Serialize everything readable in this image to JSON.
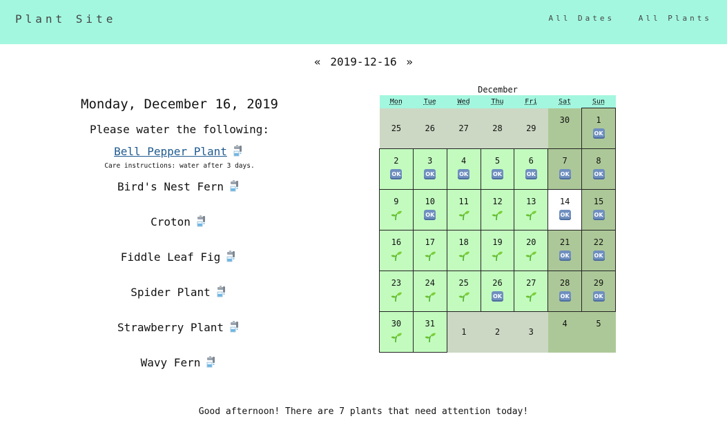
{
  "header": {
    "brand": "Plant Site",
    "nav": [
      "All Dates",
      "All Plants"
    ],
    "background": "#a3f7df"
  },
  "date_nav": {
    "prev": "«",
    "date": "2019-12-16",
    "next": "»"
  },
  "main": {
    "day_title": "Monday, December 16, 2019",
    "prompt": "Please water the following:",
    "plants": [
      {
        "name": "Bell Pepper Plant",
        "link": true,
        "care": "Care instructions: water after 3 days.",
        "icon": "watering-tap-icon"
      },
      {
        "name": "Bird's Nest Fern",
        "link": false,
        "icon": "watering-tap-icon"
      },
      {
        "name": "Croton",
        "link": false,
        "icon": "watering-tap-icon"
      },
      {
        "name": "Fiddle Leaf Fig",
        "link": false,
        "icon": "watering-tap-icon"
      },
      {
        "name": "Spider Plant",
        "link": false,
        "icon": "watering-tap-icon"
      },
      {
        "name": "Strawberry Plant",
        "link": false,
        "icon": "watering-tap-icon"
      },
      {
        "name": "Wavy Fern",
        "link": false,
        "icon": "watering-tap-icon"
      }
    ]
  },
  "calendar": {
    "month": "December",
    "weekdays": [
      "Mon",
      "Tue",
      "Wed",
      "Thu",
      "Fri",
      "Sat",
      "Sun"
    ],
    "weeks": [
      [
        {
          "day": "25",
          "type": "outside",
          "icon": "none"
        },
        {
          "day": "26",
          "type": "outside",
          "icon": "none"
        },
        {
          "day": "27",
          "type": "outside",
          "icon": "none"
        },
        {
          "day": "28",
          "type": "outside",
          "icon": "none"
        },
        {
          "day": "29",
          "type": "outside",
          "icon": "none"
        },
        {
          "day": "30",
          "type": "outwk",
          "icon": "none"
        },
        {
          "day": "1",
          "type": "curwk",
          "icon": "ok"
        }
      ],
      [
        {
          "day": "2",
          "type": "cur",
          "icon": "ok"
        },
        {
          "day": "3",
          "type": "cur",
          "icon": "ok"
        },
        {
          "day": "4",
          "type": "cur",
          "icon": "ok"
        },
        {
          "day": "5",
          "type": "cur",
          "icon": "ok"
        },
        {
          "day": "6",
          "type": "cur",
          "icon": "ok"
        },
        {
          "day": "7",
          "type": "curwk",
          "icon": "ok"
        },
        {
          "day": "8",
          "type": "curwk",
          "icon": "ok"
        }
      ],
      [
        {
          "day": "9",
          "type": "cur",
          "icon": "sprout"
        },
        {
          "day": "10",
          "type": "cur",
          "icon": "ok"
        },
        {
          "day": "11",
          "type": "cur",
          "icon": "sprout"
        },
        {
          "day": "12",
          "type": "cur",
          "icon": "sprout"
        },
        {
          "day": "13",
          "type": "cur",
          "icon": "sprout"
        },
        {
          "day": "14",
          "type": "today",
          "icon": "ok"
        },
        {
          "day": "15",
          "type": "curwk",
          "icon": "ok"
        }
      ],
      [
        {
          "day": "16",
          "type": "cur",
          "icon": "sprout"
        },
        {
          "day": "17",
          "type": "cur",
          "icon": "sprout"
        },
        {
          "day": "18",
          "type": "cur",
          "icon": "sprout"
        },
        {
          "day": "19",
          "type": "cur",
          "icon": "sprout"
        },
        {
          "day": "20",
          "type": "cur",
          "icon": "sprout"
        },
        {
          "day": "21",
          "type": "curwk",
          "icon": "ok"
        },
        {
          "day": "22",
          "type": "curwk",
          "icon": "ok"
        }
      ],
      [
        {
          "day": "23",
          "type": "cur",
          "icon": "sprout"
        },
        {
          "day": "24",
          "type": "cur",
          "icon": "sprout"
        },
        {
          "day": "25",
          "type": "cur",
          "icon": "sprout"
        },
        {
          "day": "26",
          "type": "cur",
          "icon": "ok"
        },
        {
          "day": "27",
          "type": "cur",
          "icon": "sprout"
        },
        {
          "day": "28",
          "type": "curwk",
          "icon": "ok"
        },
        {
          "day": "29",
          "type": "curwk",
          "icon": "ok"
        }
      ],
      [
        {
          "day": "30",
          "type": "cur",
          "icon": "sprout"
        },
        {
          "day": "31",
          "type": "cur",
          "icon": "sprout"
        },
        {
          "day": "1",
          "type": "outside",
          "icon": "none"
        },
        {
          "day": "2",
          "type": "outside",
          "icon": "none"
        },
        {
          "day": "3",
          "type": "outside",
          "icon": "none"
        },
        {
          "day": "4",
          "type": "outwk",
          "icon": "none"
        },
        {
          "day": "5",
          "type": "outwk",
          "icon": "none"
        }
      ]
    ],
    "ok_label": "OK",
    "colors": {
      "current_weekday": "#c3fbbf",
      "current_weekend": "#adc898",
      "today": "#ffffff",
      "outside_weekday": "#ccd8c4",
      "outside_weekend": "#adc898"
    }
  },
  "footer": {
    "message": "Good afternoon! There are 7 plants that need attention today!"
  }
}
